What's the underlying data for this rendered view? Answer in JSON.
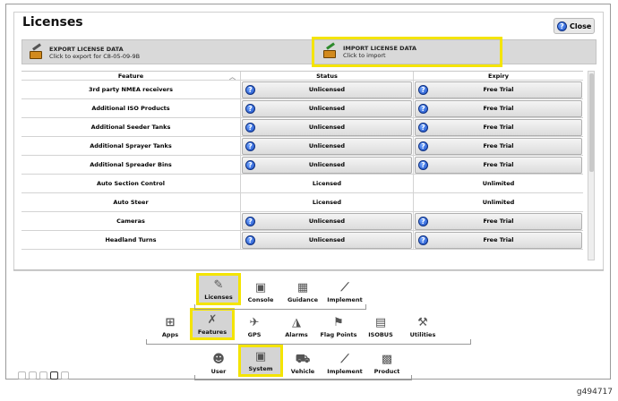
{
  "window": {
    "title": "Licenses",
    "close_label": "Close"
  },
  "actions": {
    "export_title": "EXPORT LICENSE DATA",
    "export_sub": "Click to export for C8-05-09-9B",
    "import_title": "IMPORT LICENSE DATA",
    "import_sub": "Click to import"
  },
  "table": {
    "headers": {
      "feature": "Feature",
      "status": "Status",
      "expiry": "Expiry"
    },
    "rows": [
      {
        "feature": "3rd party NMEA receivers",
        "status": "Unlicensed",
        "expiry": "Free Trial",
        "button": true
      },
      {
        "feature": "Additional ISO Products",
        "status": "Unlicensed",
        "expiry": "Free Trial",
        "button": true
      },
      {
        "feature": "Additional Seeder Tanks",
        "status": "Unlicensed",
        "expiry": "Free Trial",
        "button": true
      },
      {
        "feature": "Additional Sprayer Tanks",
        "status": "Unlicensed",
        "expiry": "Free Trial",
        "button": true
      },
      {
        "feature": "Additional Spreader Bins",
        "status": "Unlicensed",
        "expiry": "Free Trial",
        "button": true
      },
      {
        "feature": "Auto Section Control",
        "status": "Licensed",
        "expiry": "Unlimited",
        "button": false
      },
      {
        "feature": "Auto Steer",
        "status": "Licensed",
        "expiry": "Unlimited",
        "button": false
      },
      {
        "feature": "Cameras",
        "status": "Unlicensed",
        "expiry": "Free Trial",
        "button": true
      },
      {
        "feature": "Headland Turns",
        "status": "Unlicensed",
        "expiry": "Free Trial",
        "button": true
      }
    ]
  },
  "nav": {
    "row1": [
      {
        "label": "Licenses",
        "icon": "licenses-icon"
      },
      {
        "label": "Console",
        "icon": "console-icon"
      },
      {
        "label": "Guidance",
        "icon": "guidance-icon"
      },
      {
        "label": "Implement",
        "icon": "implement-icon"
      }
    ],
    "row2": [
      {
        "label": "Apps",
        "icon": "apps-icon"
      },
      {
        "label": "Features",
        "icon": "features-icon"
      },
      {
        "label": "GPS",
        "icon": "gps-icon"
      },
      {
        "label": "Alarms",
        "icon": "alarms-icon"
      },
      {
        "label": "Flag Points",
        "icon": "flag-points-icon"
      },
      {
        "label": "ISOBUS",
        "icon": "isobus-icon"
      },
      {
        "label": "Utilities",
        "icon": "utilities-icon"
      }
    ],
    "row3": [
      {
        "label": "User",
        "icon": "user-icon"
      },
      {
        "label": "System",
        "icon": "system-icon"
      },
      {
        "label": "Vehicle",
        "icon": "vehicle-icon"
      },
      {
        "label": "Implement",
        "icon": "implement-icon"
      },
      {
        "label": "Product",
        "icon": "product-icon"
      }
    ]
  },
  "figure_id": "g494717",
  "colors": {
    "highlight": "#f4e400",
    "help_blue": "#1d4fc4"
  }
}
